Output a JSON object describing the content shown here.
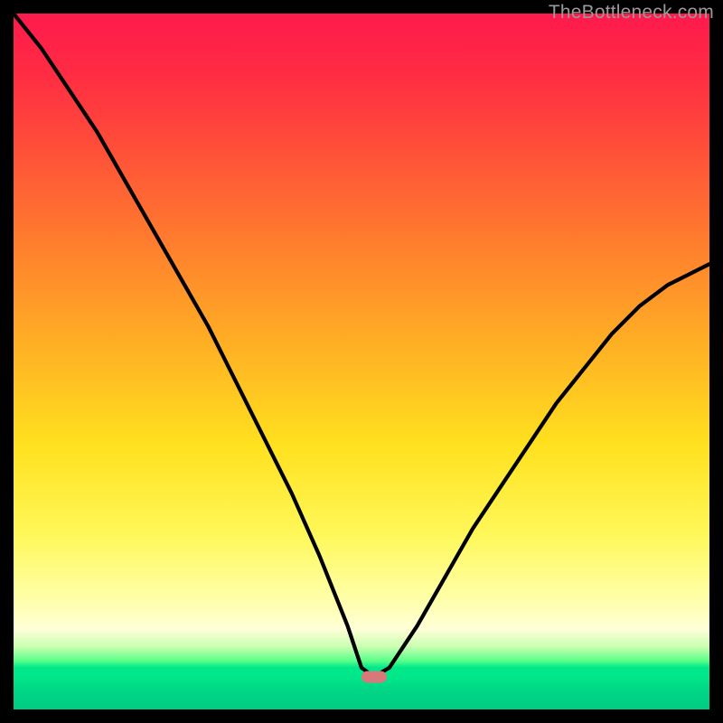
{
  "watermark": "TheBottleneck.com",
  "marker": {
    "x_pct": 51.8,
    "y_pct": 95.3
  },
  "chart_data": {
    "type": "line",
    "title": "",
    "xlabel": "",
    "ylabel": "",
    "xlim": [
      0,
      100
    ],
    "ylim": [
      0,
      100
    ],
    "x": [
      0,
      4,
      8,
      12,
      16,
      20,
      24,
      28,
      32,
      36,
      40,
      44,
      48,
      50,
      51.8,
      54,
      58,
      62,
      66,
      70,
      74,
      78,
      82,
      86,
      90,
      94,
      98,
      100
    ],
    "y": [
      100,
      95,
      89,
      83,
      76,
      69,
      62,
      55,
      47,
      39,
      31,
      22,
      12,
      6,
      4.7,
      6,
      12,
      19,
      26,
      32,
      38,
      44,
      49,
      54,
      58,
      61,
      63,
      64
    ],
    "minimum": {
      "x": 51.8,
      "y": 4.7
    },
    "background_gradient_note": "color encodes bottleneck severity from red (high) at top to green (none) at bottom",
    "annotations": []
  }
}
